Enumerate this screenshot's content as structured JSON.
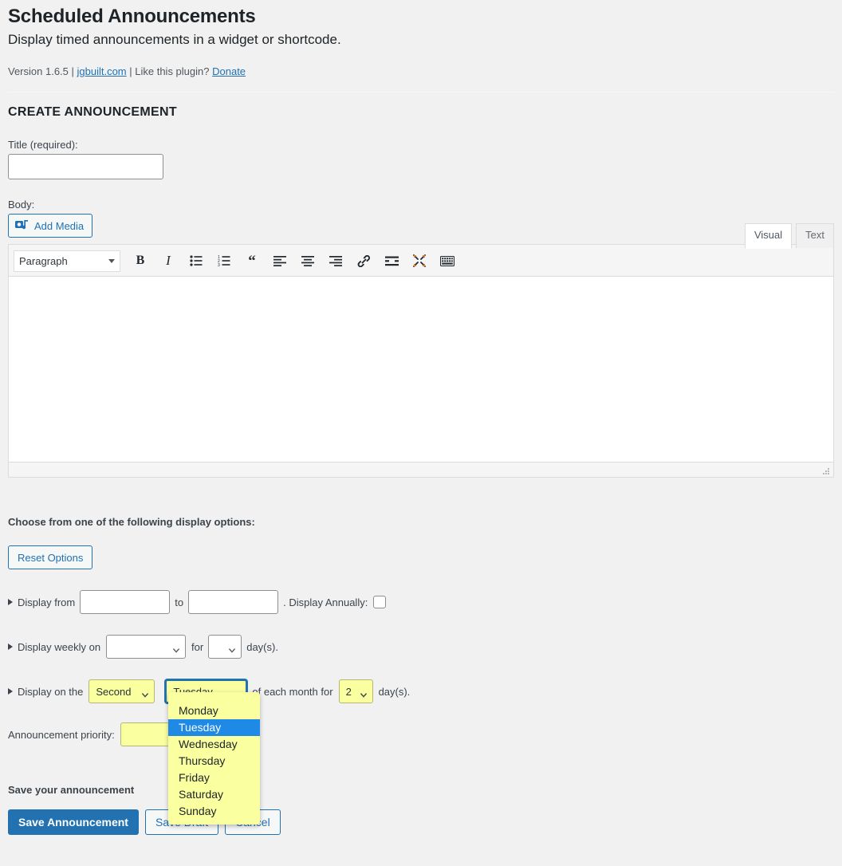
{
  "header": {
    "title": "Scheduled Announcements",
    "subtitle": "Display timed announcements in a widget or shortcode.",
    "version_text": "Version 1.6.5 |",
    "site_link": "jgbuilt.com",
    "like_text": "| Like this plugin?",
    "donate_link": "Donate"
  },
  "create_section": {
    "heading": "CREATE ANNOUNCEMENT",
    "title_label": "Title (required):",
    "title_value": "",
    "title_placeholder": "",
    "body_label": "Body:",
    "add_media_label": "Add Media"
  },
  "editor": {
    "tabs": [
      {
        "label": "Visual",
        "active": true
      },
      {
        "label": "Text",
        "active": false
      }
    ],
    "format_select": "Paragraph",
    "toolbar": [
      {
        "name": "bold-icon",
        "glyph": "B"
      },
      {
        "name": "italic-icon",
        "glyph": "I"
      },
      {
        "name": "bulleted-list-icon",
        "glyph": ""
      },
      {
        "name": "numbered-list-icon",
        "glyph": ""
      },
      {
        "name": "blockquote-icon",
        "glyph": ""
      },
      {
        "name": "align-left-icon",
        "glyph": ""
      },
      {
        "name": "align-center-icon",
        "glyph": ""
      },
      {
        "name": "align-right-icon",
        "glyph": ""
      },
      {
        "name": "insert-link-icon",
        "glyph": ""
      },
      {
        "name": "insert-read-more-icon",
        "glyph": ""
      },
      {
        "name": "fullscreen-icon",
        "glyph": ""
      },
      {
        "name": "keyboard-shortcuts-icon",
        "glyph": ""
      }
    ],
    "content": ""
  },
  "options": {
    "heading": "Choose from one of the following display options:",
    "reset_label": "Reset Options",
    "row_range": {
      "prefix": "Display from",
      "from_value": "",
      "middle": "to",
      "to_value": "",
      "suffix": ". Display Annually:",
      "annually_checked": false
    },
    "row_weekly": {
      "prefix": "Display weekly on",
      "day_value": "",
      "middle": "for",
      "count_value": "",
      "suffix": "day(s)."
    },
    "row_monthly": {
      "prefix": "Display on the",
      "ordinal_value": "Second",
      "day_value": "Tuesday",
      "middle": "of each month for",
      "count_value": "2",
      "suffix": "day(s)."
    },
    "priority": {
      "label": "Announcement priority:",
      "value": ""
    }
  },
  "dropdown": {
    "open": true,
    "selected": "Tuesday",
    "items": [
      "Monday",
      "Tuesday",
      "Wednesday",
      "Thursday",
      "Friday",
      "Saturday",
      "Sunday"
    ],
    "highlight_color": "#1e8ae5",
    "background_color": "#faffa0"
  },
  "save": {
    "heading": "Save your announcement",
    "primary_label": "Save Announcement",
    "secondary_label": "Save Draft",
    "cancel_label": "Cancel"
  },
  "colors": {
    "page_bg": "#f1f1f1",
    "accent": "#2271b1",
    "autofill_yellow": "#faffa0",
    "text": "#3c434a"
  }
}
